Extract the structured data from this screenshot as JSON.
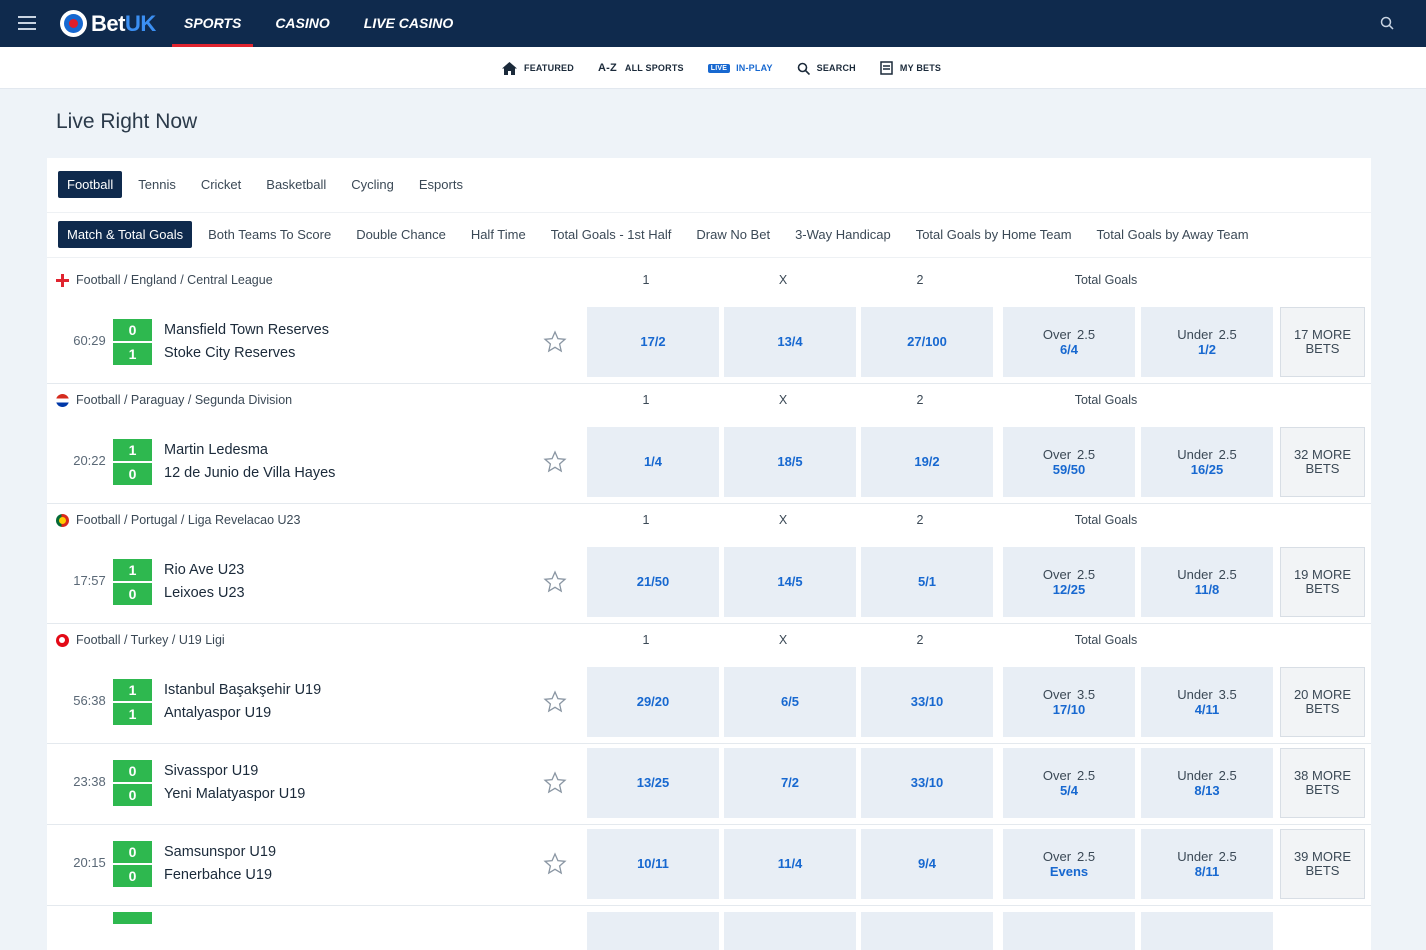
{
  "brand": {
    "name_left": "Bet",
    "name_right": "UK"
  },
  "topnav": [
    {
      "label": "SPORTS",
      "active": true
    },
    {
      "label": "CASINO",
      "active": false
    },
    {
      "label": "LIVE CASINO",
      "active": false
    }
  ],
  "subnav": {
    "featured": "FEATURED",
    "az": "A-Z",
    "all_sports": "ALL SPORTS",
    "live_badge": "LIVE",
    "in_play": "IN-PLAY",
    "search": "SEARCH",
    "my_bets": "MY BETS"
  },
  "page_title": "Live Right Now",
  "sport_tabs": [
    "Football",
    "Tennis",
    "Cricket",
    "Basketball",
    "Cycling",
    "Esports"
  ],
  "market_tabs": [
    "Match & Total Goals",
    "Both Teams To Score",
    "Double Chance",
    "Half Time",
    "Total Goals - 1st Half",
    "Draw No Bet",
    "3-Way Handicap",
    "Total Goals by Home Team",
    "Total Goals by Away Team"
  ],
  "columns": {
    "home": "1",
    "draw": "X",
    "away": "2",
    "total": "Total Goals"
  },
  "leagues": [
    {
      "name": "Football / England / Central League",
      "flag": "england"
    },
    {
      "name": "Football / Paraguay / Segunda Division",
      "flag": "paraguay"
    },
    {
      "name": "Football / Portugal / Liga Revelacao U23",
      "flag": "portugal"
    },
    {
      "name": "Football / Turkey / U19 Ligi",
      "flag": "turkey"
    }
  ],
  "events": [
    {
      "clock": "60:29",
      "home_score": "0",
      "away_score": "1",
      "home": "Mansfield Town Reserves",
      "away": "Stoke City Reserves",
      "odds_1": "17/2",
      "odds_x": "13/4",
      "odds_2": "27/100",
      "over_label": "Over",
      "over_line": "2.5",
      "over_price": "6/4",
      "under_label": "Under",
      "under_line": "2.5",
      "under_price": "1/2",
      "more": "17 MORE BETS"
    },
    {
      "clock": "20:22",
      "home_score": "1",
      "away_score": "0",
      "home": "Martin Ledesma",
      "away": "12 de Junio de Villa Hayes",
      "odds_1": "1/4",
      "odds_x": "18/5",
      "odds_2": "19/2",
      "over_label": "Over",
      "over_line": "2.5",
      "over_price": "59/50",
      "under_label": "Under",
      "under_line": "2.5",
      "under_price": "16/25",
      "more": "32 MORE BETS"
    },
    {
      "clock": "17:57",
      "home_score": "1",
      "away_score": "0",
      "home": "Rio Ave U23",
      "away": "Leixoes U23",
      "odds_1": "21/50",
      "odds_x": "14/5",
      "odds_2": "5/1",
      "over_label": "Over",
      "over_line": "2.5",
      "over_price": "12/25",
      "under_label": "Under",
      "under_line": "2.5",
      "under_price": "11/8",
      "more": "19 MORE BETS"
    },
    {
      "clock": "56:38",
      "home_score": "1",
      "away_score": "1",
      "home": "Istanbul Başakşehir U19",
      "away": "Antalyaspor U19",
      "odds_1": "29/20",
      "odds_x": "6/5",
      "odds_2": "33/10",
      "over_label": "Over",
      "over_line": "3.5",
      "over_price": "17/10",
      "under_label": "Under",
      "under_line": "3.5",
      "under_price": "4/11",
      "more": "20 MORE BETS"
    },
    {
      "clock": "23:38",
      "home_score": "0",
      "away_score": "0",
      "home": "Sivasspor U19",
      "away": "Yeni Malatyaspor U19",
      "odds_1": "13/25",
      "odds_x": "7/2",
      "odds_2": "33/10",
      "over_label": "Over",
      "over_line": "2.5",
      "over_price": "5/4",
      "under_label": "Under",
      "under_line": "2.5",
      "under_price": "8/13",
      "more": "38 MORE BETS"
    },
    {
      "clock": "20:15",
      "home_score": "0",
      "away_score": "0",
      "home": "Samsunspor U19",
      "away": "Fenerbahce U19",
      "odds_1": "10/11",
      "odds_x": "11/4",
      "odds_2": "9/4",
      "over_label": "Over",
      "over_line": "2.5",
      "over_price": "Evens",
      "under_label": "Under",
      "under_line": "2.5",
      "under_price": "8/11",
      "more": "39 MORE BETS"
    }
  ],
  "colors": {
    "navbar": "#0f2a4d",
    "accent_red": "#e0242f",
    "link_blue": "#1768d0",
    "score_green": "#2eb84f",
    "odds_bg": "#e8eef5"
  }
}
